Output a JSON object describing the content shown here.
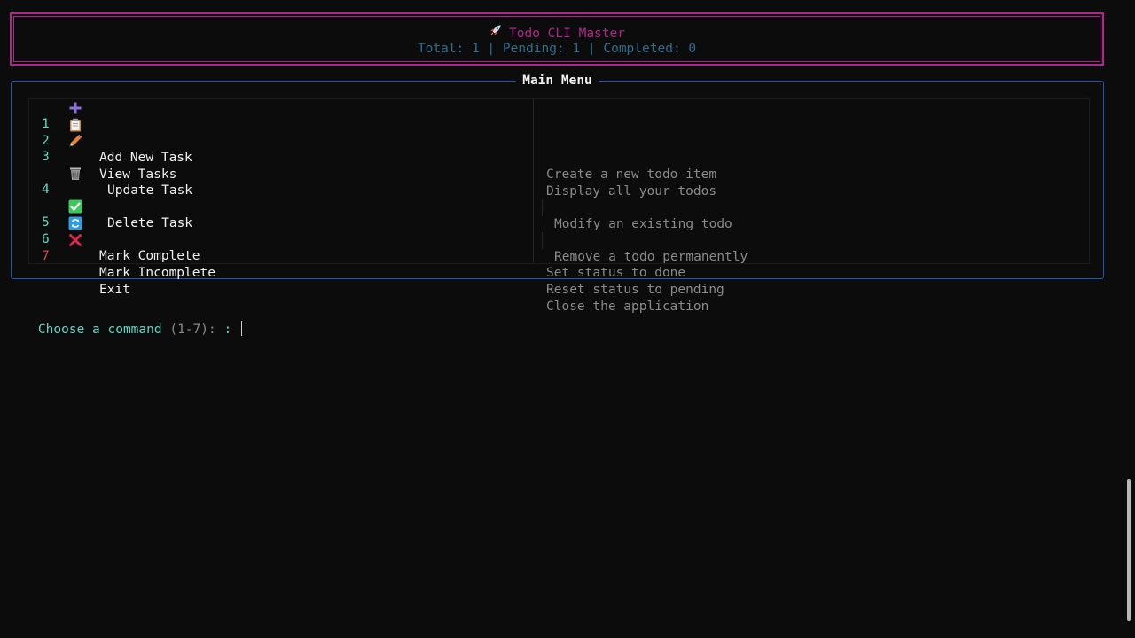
{
  "header": {
    "title": "Todo CLI Master",
    "stats": "Total: 1 | Pending: 1 | Completed: 0"
  },
  "menu": {
    "title": "Main Menu",
    "items": [
      {
        "number": "1",
        "icon": "plus-icon",
        "label": "Add New Task",
        "description": "Create a new todo item"
      },
      {
        "number": "2",
        "icon": "clipboard-icon",
        "label": "View Tasks",
        "description": "Display all your todos"
      },
      {
        "number": "3",
        "icon": "pencil-icon",
        "label": "Update Task",
        "description": "Modify an existing todo"
      },
      {
        "number": "4",
        "icon": "wastebasket-icon",
        "label": "Delete Task",
        "description": "Remove a todo permanently"
      },
      {
        "number": "5",
        "icon": "check-mark-icon",
        "label": "Mark Complete",
        "description": "Set status to done"
      },
      {
        "number": "6",
        "icon": "refresh-icon",
        "label": "Mark Incomplete",
        "description": "Reset status to pending"
      },
      {
        "number": "7",
        "icon": "cross-mark-icon",
        "label": "Exit",
        "description": "Close the application"
      }
    ]
  },
  "prompt": {
    "text": "Choose a command",
    "range": "(1-7):",
    "suffix": ": "
  },
  "colors": {
    "header_border": "#b0268f",
    "header_title": "#b0268f",
    "stats": "#2d6e8e",
    "menu_border": "#1f56b8",
    "number": "#61d6c4",
    "exit_number": "#e0424f",
    "description": "#8a8a8a"
  }
}
